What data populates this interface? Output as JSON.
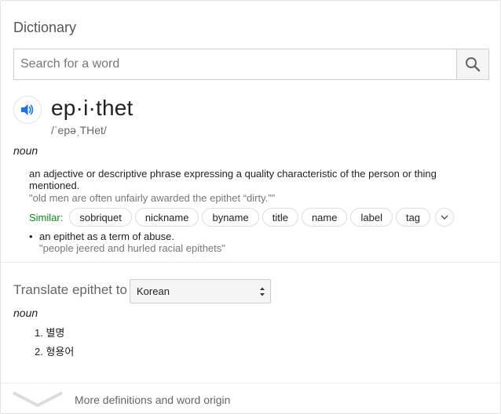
{
  "header": {
    "title": "Dictionary"
  },
  "search": {
    "placeholder": "Search for a word",
    "value": ""
  },
  "entry": {
    "word": "ep·i·thet",
    "phonetic": "/ˈepəˌTHet/",
    "part_of_speech": "noun",
    "definitions": [
      {
        "text": "an adjective or descriptive phrase expressing a quality characteristic of the person or thing mentioned.",
        "example": "\"old men are often unfairly awarded the epithet “dirty.”\"",
        "similar_label": "Similar:",
        "similar": [
          "sobriquet",
          "nickname",
          "byname",
          "title",
          "name",
          "label",
          "tag"
        ]
      },
      {
        "bullet": "•",
        "text": "an epithet as a term of abuse.",
        "example": "\"people jeered and hurled racial epithets\""
      }
    ]
  },
  "translate": {
    "label": "Translate epithet to",
    "language": "Korean",
    "part_of_speech": "noun",
    "items": [
      "1. 별명",
      "2. 형용어"
    ]
  },
  "footer": {
    "more_label": "More definitions and word origin"
  },
  "colors": {
    "similar_green": "#0a8a1f",
    "speaker_blue": "#1a73e8"
  }
}
